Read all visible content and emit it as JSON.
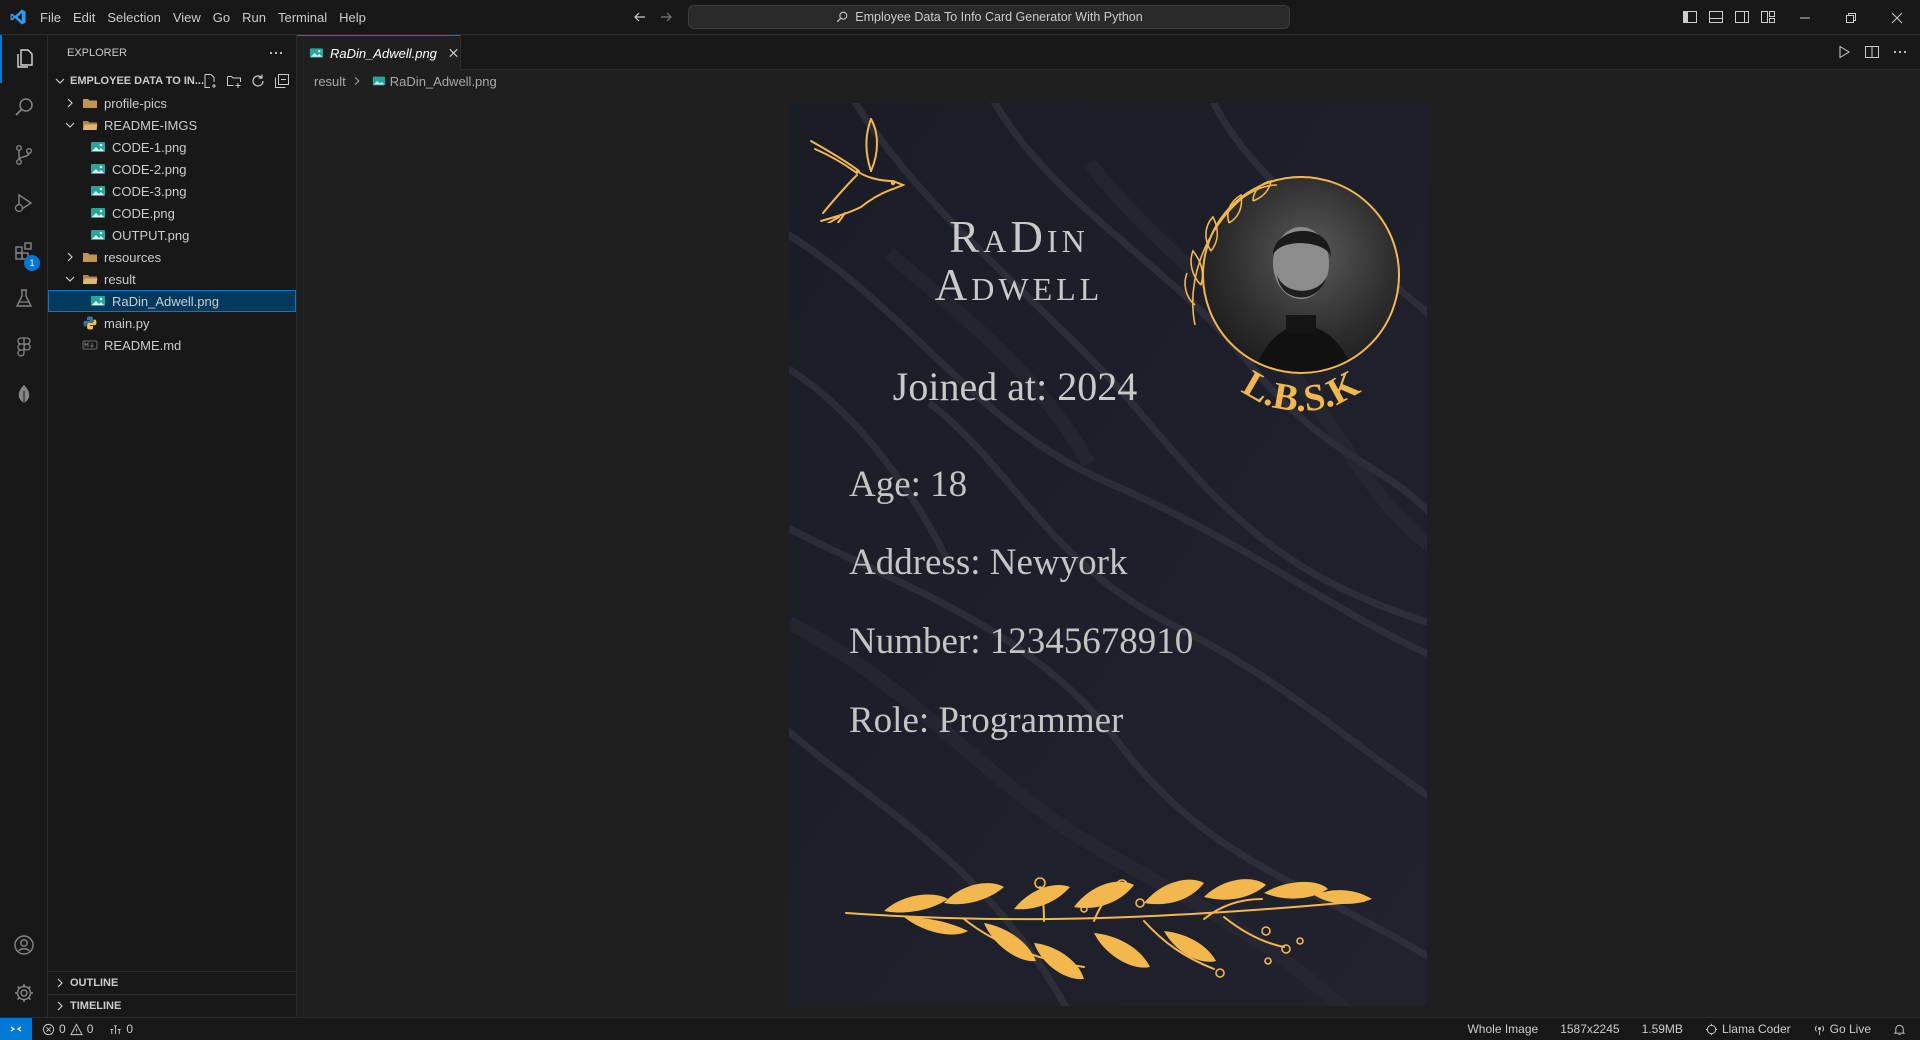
{
  "menu": [
    "File",
    "Edit",
    "Selection",
    "View",
    "Go",
    "Run",
    "Terminal",
    "Help"
  ],
  "command_center": {
    "text": "Employee Data To Info Card Generator With Python"
  },
  "sidebar": {
    "title": "EXPLORER",
    "workspace": "EMPLOYEE DATA TO IN...",
    "tree": [
      {
        "label": "profile-pics",
        "kind": "folder",
        "expanded": false,
        "depth": 0
      },
      {
        "label": "README-IMGS",
        "kind": "folder",
        "expanded": true,
        "depth": 0
      },
      {
        "label": "CODE-1.png",
        "kind": "image",
        "depth": 1
      },
      {
        "label": "CODE-2.png",
        "kind": "image",
        "depth": 1
      },
      {
        "label": "CODE-3.png",
        "kind": "image",
        "depth": 1
      },
      {
        "label": "CODE.png",
        "kind": "image",
        "depth": 1
      },
      {
        "label": "OUTPUT.png",
        "kind": "image",
        "depth": 1
      },
      {
        "label": "resources",
        "kind": "folder",
        "expanded": false,
        "depth": 0
      },
      {
        "label": "result",
        "kind": "folder",
        "expanded": true,
        "depth": 0
      },
      {
        "label": "RaDin_Adwell.png",
        "kind": "image",
        "depth": 1,
        "selected": true
      },
      {
        "label": "main.py",
        "kind": "python",
        "depth": 0
      },
      {
        "label": "README.md",
        "kind": "markdown",
        "depth": 0
      }
    ],
    "outline": "OUTLINE",
    "timeline": "TIMELINE"
  },
  "activity": {
    "extensions_badge": "1"
  },
  "editor": {
    "tab_label": "RaDin_Adwell.png",
    "breadcrumb": [
      "result",
      "RaDin_Adwell.png"
    ]
  },
  "card": {
    "name_line1": "RaDin",
    "name_line2": "Adwell",
    "joined": "Joined at: 2024",
    "age": "Age: 18",
    "address": "Address: Newyork",
    "number": "Number: 12345678910",
    "role": "Role: Programmer",
    "logo_text": "L.B.S.K",
    "accent": "#f3b84d"
  },
  "status": {
    "errors": "0",
    "warnings": "0",
    "ports": "0",
    "image_mode": "Whole Image",
    "dimensions": "1587x2245",
    "size": "1.59MB",
    "llama": "Llama Coder",
    "golive": "Go Live"
  },
  "colors": {
    "accent_blue": "#0078d4",
    "background": "#1f1f1f",
    "sidebar": "#181818"
  }
}
